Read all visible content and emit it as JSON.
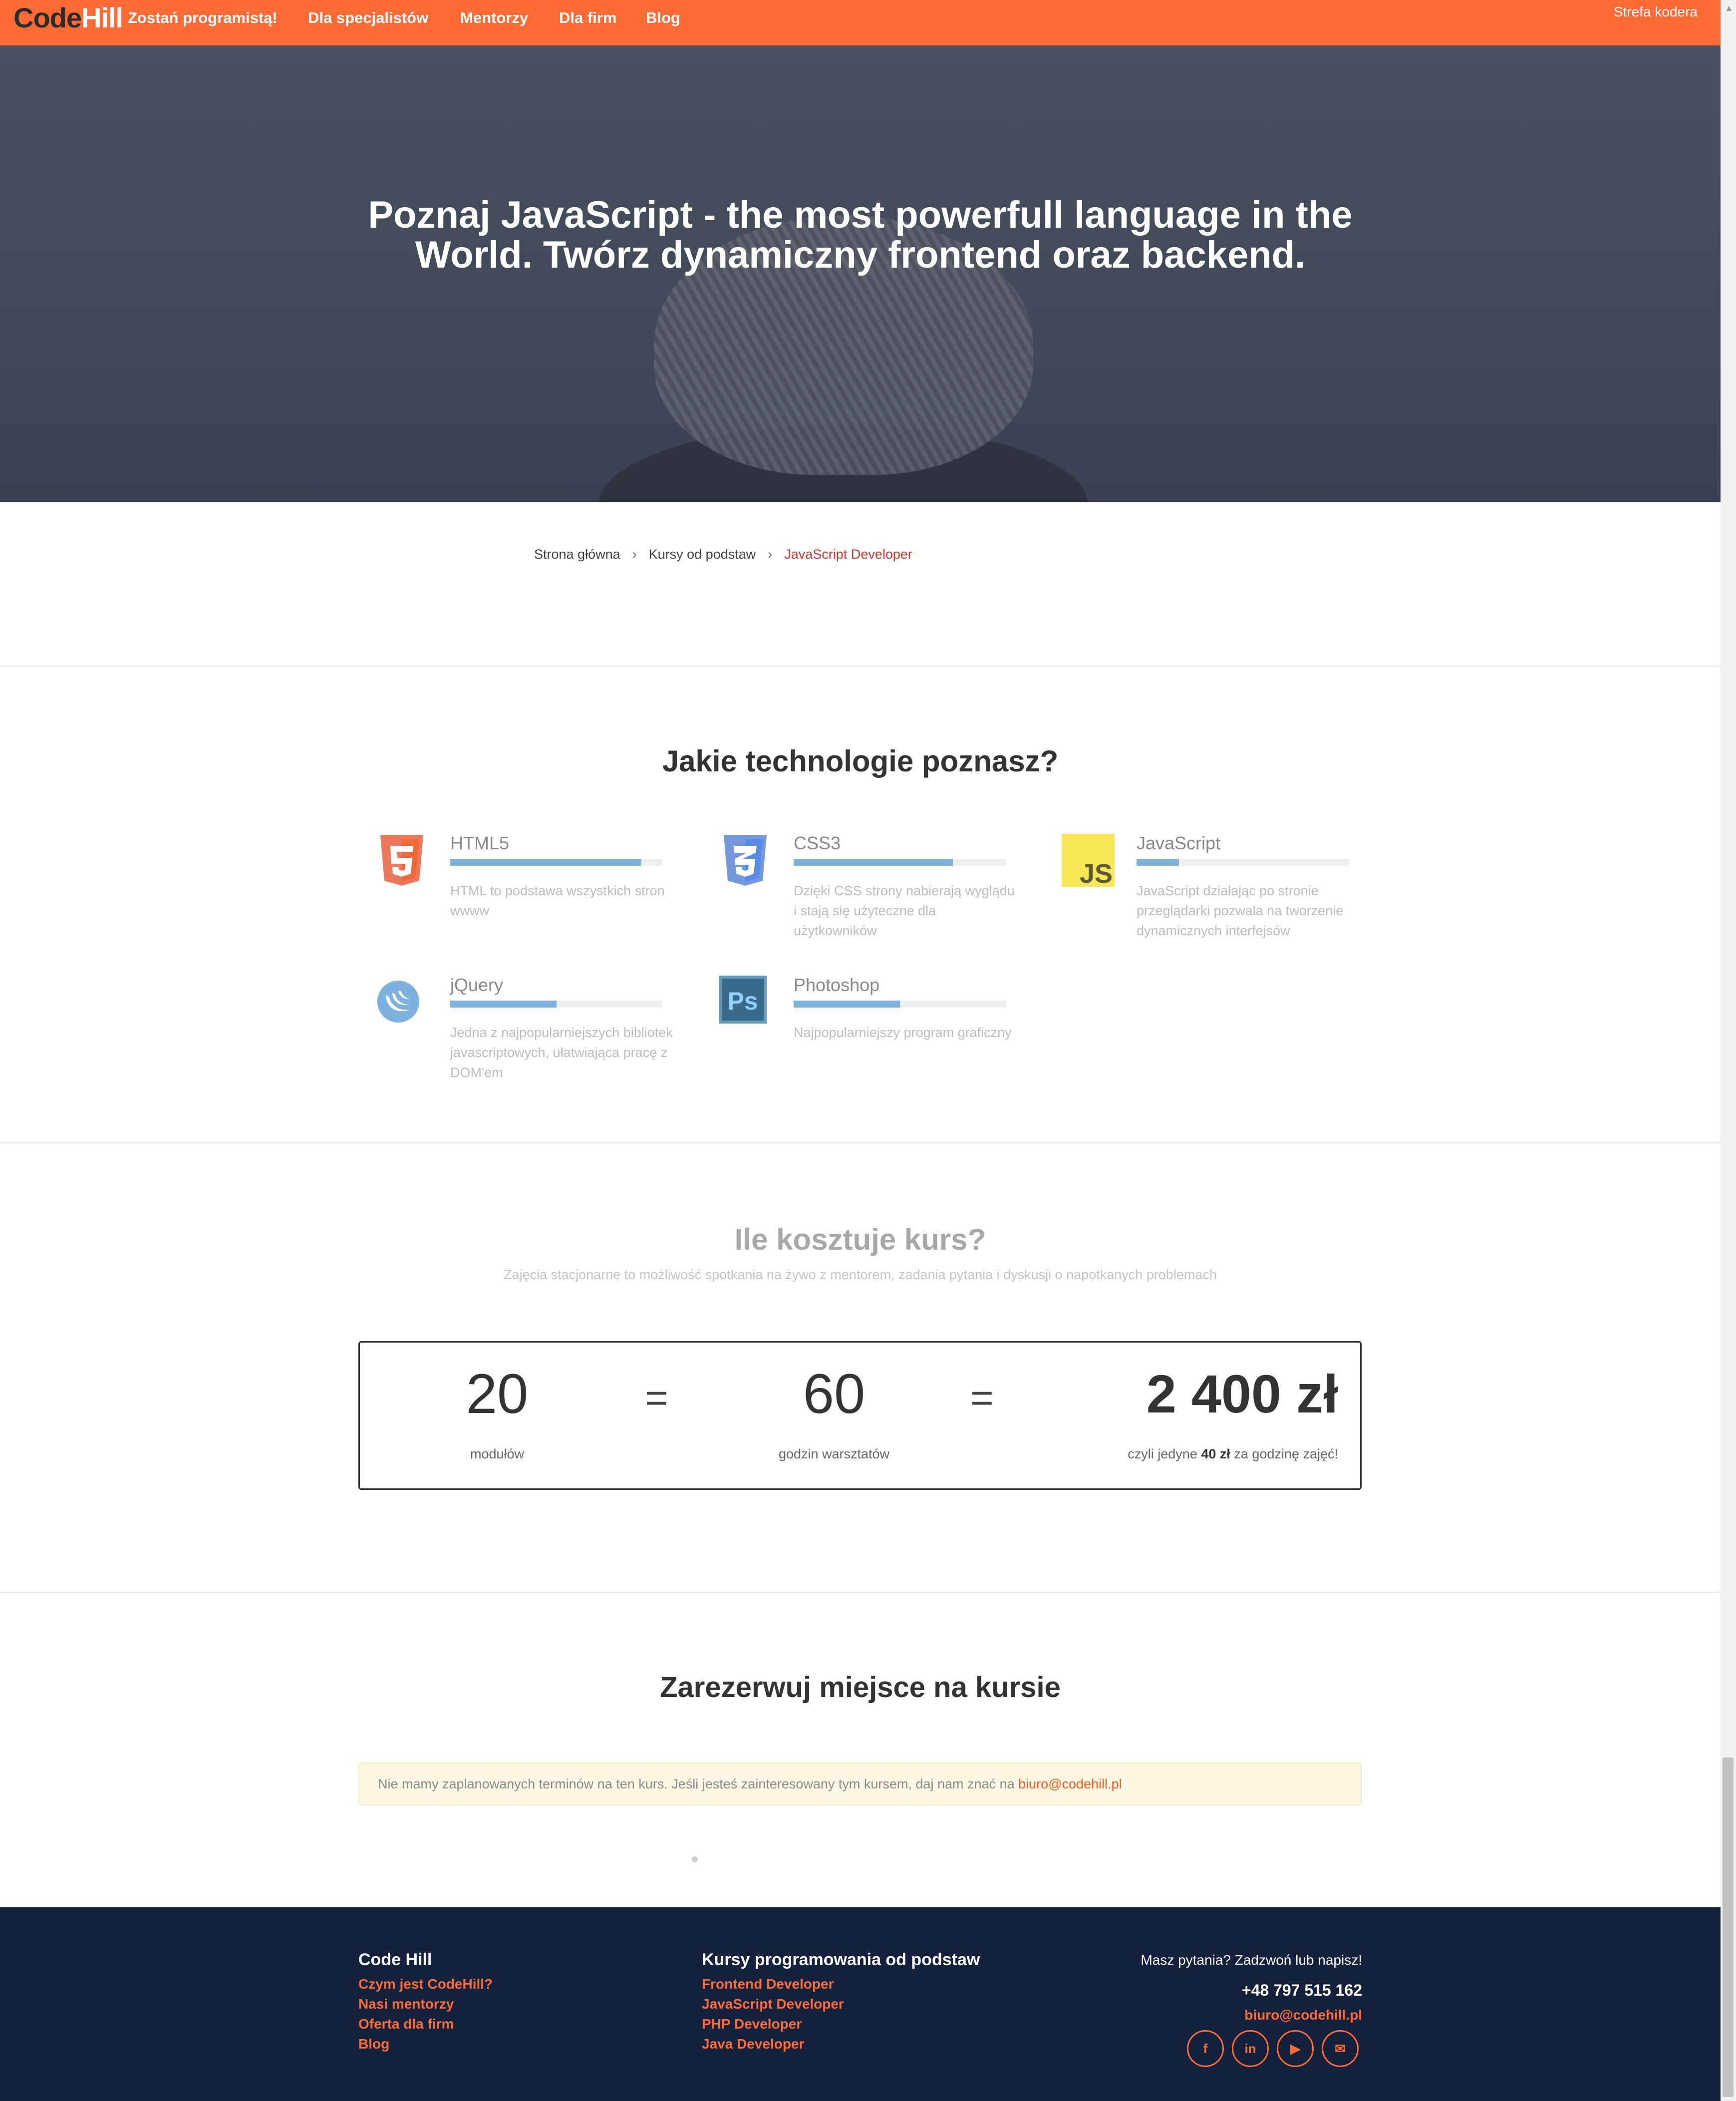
{
  "nav": {
    "logo_a": "Code",
    "logo_b": "Hill",
    "items": [
      "Zostań programistą!",
      "Dla specjalistów",
      "Mentorzy",
      "Dla firm",
      "Blog"
    ],
    "right": "Strefa kodera"
  },
  "hero": {
    "title_line1": "Poznaj JavaScript - the most powerfull language in the",
    "title_line2": "World. Twórz dynamiczny frontend oraz backend."
  },
  "breadcrumb": {
    "home": "Strona główna",
    "parent": "Kursy od podstaw",
    "current": "JavaScript Developer",
    "separator": "›"
  },
  "technologies": {
    "title": "Jakie technologie poznasz?",
    "items": [
      {
        "name": "HTML5",
        "progress": 0.9,
        "desc": "HTML to podstawa wszystkich stron wwww",
        "icon": "html5-icon",
        "color": "#e44d26"
      },
      {
        "name": "CSS3",
        "progress": 0.75,
        "desc": "Dzięki CSS strony nabierają wyglądu i stają się użyteczne dla użytkowników",
        "icon": "css3-icon",
        "color": "#264de4"
      },
      {
        "name": "JavaScript",
        "progress": 0.2,
        "desc": "JavaScript działając po stronie przeglądarki pozwala na tworzenie dynamicznych interfejsów",
        "icon": "javascript-icon",
        "color": "#f7df1e"
      },
      {
        "name": "jQuery",
        "progress": 0.5,
        "desc": "Jedna z najpopularniejszych bibliotek javascriptowych, ułatwiająca pracę z DOM'em",
        "icon": "jquery-icon",
        "color": "#0769ad"
      },
      {
        "name": "Photoshop",
        "progress": 0.5,
        "desc": "Najpopularniejszy program graficzny",
        "icon": "photoshop-icon",
        "color": "#31a8ff"
      }
    ]
  },
  "pricing": {
    "title": "Ile kosztuje kurs?",
    "subtitle": "Zajęcia stacjonarne to możliwość spotkania na żywo z mentorem, zadania pytania i dyskusji o napotkanych problemach",
    "modules_value": "20",
    "modules_label": "modułów",
    "hours_value": "60",
    "hours_label": "godzin warsztatów",
    "equals": "=",
    "price_value": "2 400 zł",
    "price_label_pre": "czyli jedyne ",
    "price_label_bold": "40 zł",
    "price_label_post": " za godzinę zajęć!"
  },
  "reservation": {
    "title": "Zarezerwuj miejsce na kursie",
    "notice_text": "Nie mamy zaplanowanych terminów na ten kurs. Jeśli jesteś zainteresowany tym kursem, daj nam znać na ",
    "notice_email": "biuro@codehill.pl"
  },
  "footer": {
    "col1_head": "Code Hill",
    "col1_links": [
      "Czym jest CodeHill?",
      "Nasi mentorzy",
      "Oferta dla firm",
      "Blog"
    ],
    "col2_head": "Kursy programowania od podstaw",
    "col2_links": [
      "Frontend Developer",
      "JavaScript Developer",
      "PHP Developer",
      "Java Developer"
    ],
    "contact_prompt": "Masz pytania? Zadzwoń lub napisz!",
    "phone": "+48 797 515 162",
    "email": "biuro@codehill.pl",
    "social": [
      {
        "glyph": "f",
        "icon": "facebook-icon"
      },
      {
        "glyph": "in",
        "icon": "linkedin-icon"
      },
      {
        "glyph": "▶",
        "icon": "youtube-icon"
      },
      {
        "glyph": "✉",
        "icon": "envelope-icon"
      }
    ]
  }
}
